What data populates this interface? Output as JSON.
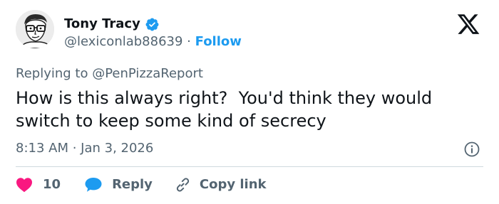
{
  "author": {
    "display_name": "Tony Tracy",
    "handle": "@lexiconlab88639",
    "separator": " · ",
    "follow_label": "Follow"
  },
  "reply_context": {
    "prefix": "Replying to ",
    "mention": "@PenPizzaReport"
  },
  "tweet": {
    "text": "How is this always right?  You'd think they would switch to keep some kind of secrecy",
    "timestamp": "8:13 AM · Jan 3, 2026"
  },
  "actions": {
    "like_count": "10",
    "reply_label": "Reply",
    "copy_link_label": "Copy link"
  },
  "icons": {
    "verified": "verified-badge-icon",
    "logo": "x-logo-icon",
    "info": "info-icon",
    "like": "heart-icon",
    "reply": "speech-bubble-icon",
    "copy": "link-icon"
  },
  "colors": {
    "text": "#0f1419",
    "secondary": "#536471",
    "accent": "#1d9bf0",
    "like": "#f91880",
    "divider": "#cfd9de"
  }
}
